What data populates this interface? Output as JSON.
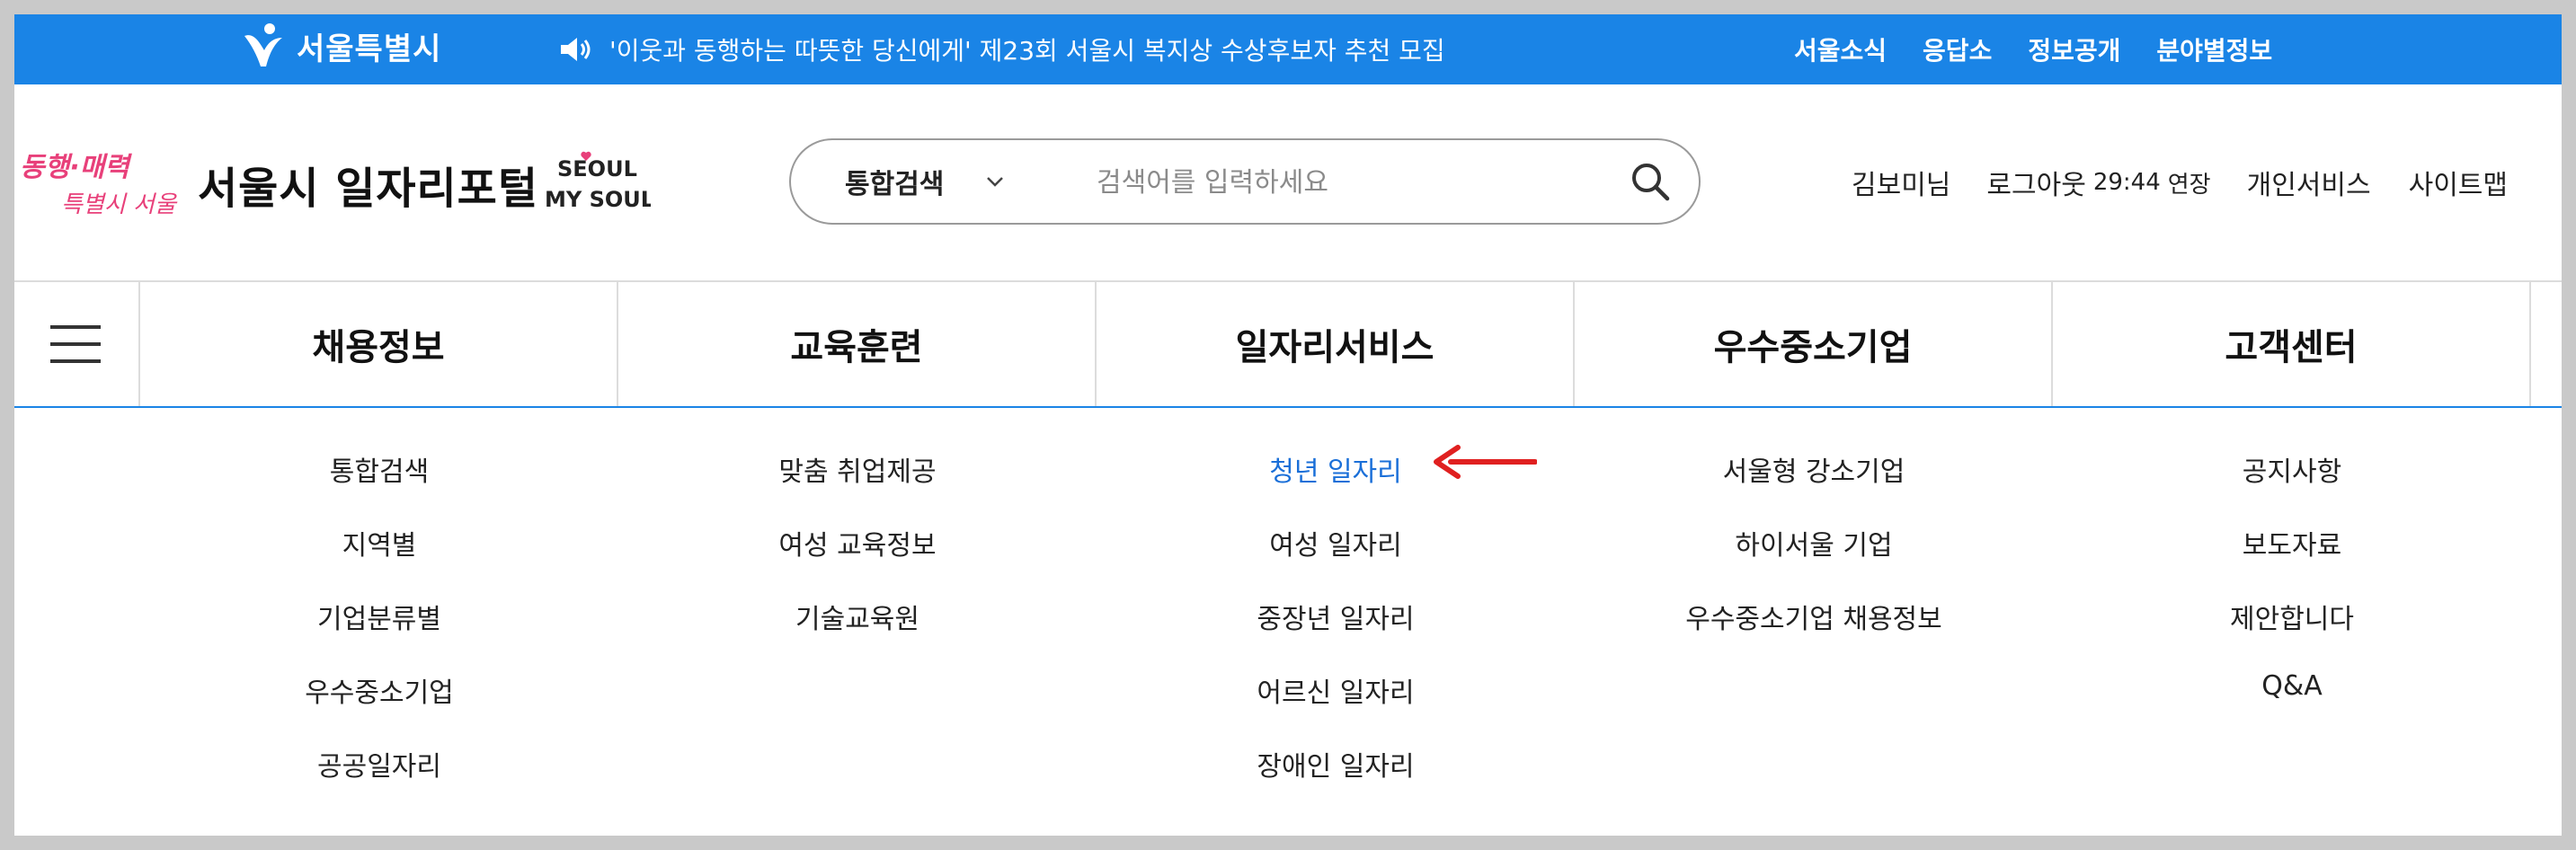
{
  "topbar": {
    "logo_text": "서울특별시",
    "announcement": "'이웃과 동행하는 따뜻한 당신에게' 제23회 서울시 복지상 수상후보자 추천 모집",
    "links": [
      "서울소식",
      "응답소",
      "정보공개",
      "분야별정보"
    ],
    "background_color": "#1a84e6"
  },
  "header": {
    "slogan_line1": "동행·매력",
    "slogan_line2": "특별시 서울",
    "site_title": "서울시 일자리포털",
    "seoul_logo_line1": "SEOUL",
    "seoul_logo_line2": "MY SOUL",
    "search": {
      "scope_selected": "통합검색",
      "placeholder": "검색어를 입력하세요",
      "value": ""
    },
    "user": {
      "name": "김보미님",
      "logout": "로그아웃",
      "timer": "29:44",
      "extend": "연장",
      "personal": "개인서비스",
      "sitemap": "사이트맵"
    }
  },
  "gnb": {
    "tabs": [
      "채용정보",
      "교육훈련",
      "일자리서비스",
      "우수중소기업",
      "고객센터"
    ]
  },
  "mega": {
    "columns": [
      [
        "통합검색",
        "지역별",
        "기업분류별",
        "우수중소기업",
        "공공일자리"
      ],
      [
        "맞춤 취업제공",
        "여성 교육정보",
        "기술교육원"
      ],
      [
        "청년 일자리",
        "여성 일자리",
        "중장년 일자리",
        "어르신 일자리",
        "장애인 일자리"
      ],
      [
        "서울형 강소기업",
        "하이서울 기업",
        "우수중소기업 채용정보"
      ],
      [
        "공지사항",
        "보도자료",
        "제안합니다",
        "Q&A"
      ]
    ],
    "active_item": "청년 일자리",
    "active_color": "#1a6fd8",
    "pointer_color": "#e02020"
  }
}
